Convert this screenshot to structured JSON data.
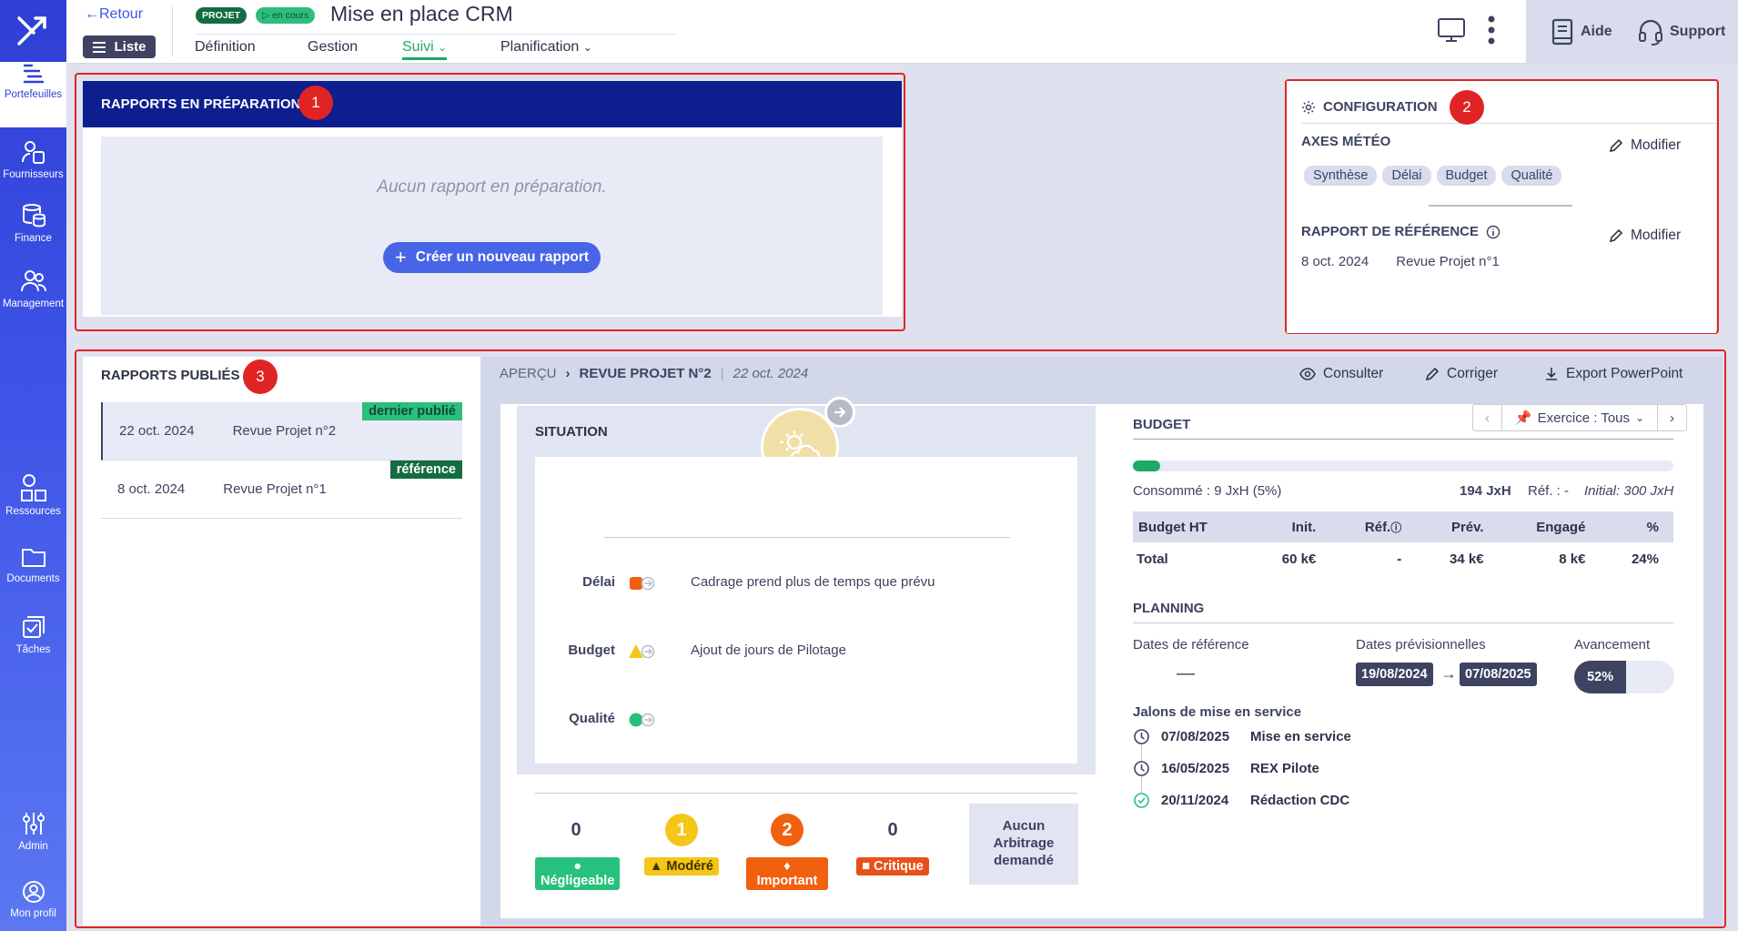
{
  "nav": {
    "items": [
      {
        "label": "Portefeuilles",
        "icon": "bars-icon"
      },
      {
        "label": "Fournisseurs",
        "icon": "supplier-icon"
      },
      {
        "label": "Finance",
        "icon": "coins-icon"
      },
      {
        "label": "Management",
        "icon": "users-icon"
      },
      {
        "label": "Ressources",
        "icon": "shapes-icon"
      },
      {
        "label": "Documents",
        "icon": "folder-icon"
      },
      {
        "label": "Tâches",
        "icon": "tasks-icon"
      },
      {
        "label": "Admin",
        "icon": "sliders-icon"
      },
      {
        "label": "Mon profil",
        "icon": "user-circle-icon"
      }
    ]
  },
  "header": {
    "back": "Retour",
    "list": "Liste",
    "badge_type": "PROJET",
    "badge_status": "en cours",
    "title": "Mise en place CRM",
    "tabs": [
      "Définition",
      "Gestion",
      "Suivi",
      "Planification"
    ],
    "active_tab": "Suivi",
    "help": "Aide",
    "support": "Support"
  },
  "annotations": [
    "1",
    "2",
    "3"
  ],
  "prep": {
    "title": "RAPPORTS EN PRÉPARATION",
    "empty": "Aucun rapport en préparation.",
    "create": "Créer un nouveau rapport"
  },
  "config": {
    "title": "CONFIGURATION",
    "axes_title": "AXES MÉTÉO",
    "modify": "Modifier",
    "axes": [
      "Synthèse",
      "Délai",
      "Budget",
      "Qualité"
    ],
    "ref_title": "RAPPORT DE RÉFÉRENCE",
    "ref_date": "8 oct. 2024",
    "ref_name": "Revue Projet n°1"
  },
  "published": {
    "title": "RAPPORTS PUBLIÉS",
    "rows": [
      {
        "date": "22 oct. 2024",
        "name": "Revue Projet n°2",
        "tag": "dernier publié"
      },
      {
        "date": "8 oct. 2024",
        "name": "Revue Projet n°1",
        "tag": "référence"
      }
    ]
  },
  "preview": {
    "crumb_root": "APERÇU",
    "crumb_report": "REVUE PROJET N°2",
    "crumb_date": "22 oct. 2024",
    "actions": [
      "Consulter",
      "Corriger",
      "Export PowerPoint"
    ],
    "situation_title": "SITUATION",
    "axes": [
      {
        "label": "Délai",
        "comment": "Cadrage prend plus de temps que prévu",
        "level": "important",
        "color": "#f0600f"
      },
      {
        "label": "Budget",
        "comment": "Ajout de jours de Pilotage",
        "level": "modere",
        "color": "#f5c518"
      },
      {
        "label": "Qualité",
        "comment": "",
        "level": "negligeable",
        "color": "#27c07d"
      }
    ],
    "severities": [
      {
        "count": "0",
        "label": "Négligeable",
        "color": "#27c07d",
        "highlight": false
      },
      {
        "count": "1",
        "label": "Modéré",
        "color": "#f5c518",
        "highlight": true
      },
      {
        "count": "2",
        "label": "Important",
        "color": "#f0600f",
        "highlight": true
      },
      {
        "count": "0",
        "label": "Critique",
        "color": "#e8501a",
        "highlight": false
      }
    ],
    "arbitrage": [
      "Aucun",
      "Arbitrage",
      "demandé"
    ]
  },
  "budget": {
    "title": "BUDGET",
    "exercise": "Exercice : Tous",
    "consumed_ratio": 0.05,
    "consumed": "Consommé : 9 JxH (5%)",
    "total_jxh": "194 JxH",
    "ref": "Réf. : -",
    "initial": "Initial: 300 JxH",
    "columns": [
      "Budget HT",
      "Init.",
      "Réf.",
      "Prév.",
      "Engagé",
      "%"
    ],
    "row": [
      "Total",
      "60 k€",
      "-",
      "34 k€",
      "8 k€",
      "24%"
    ]
  },
  "planning": {
    "title": "PLANNING",
    "ref_dates": "Dates de référence",
    "ref_value": "—",
    "prev_dates": "Dates prévisionnelles",
    "start": "19/08/2024",
    "end": "07/08/2025",
    "progress_label": "Avancement",
    "progress": "52%",
    "progress_ratio": 0.52,
    "jalons_title": "Jalons de mise en service",
    "jalons": [
      {
        "date": "07/08/2025",
        "name": "Mise en service",
        "done": false
      },
      {
        "date": "16/05/2025",
        "name": "REX Pilote",
        "done": false
      },
      {
        "date": "20/11/2024",
        "name": "Rédaction CDC",
        "done": true
      }
    ]
  }
}
